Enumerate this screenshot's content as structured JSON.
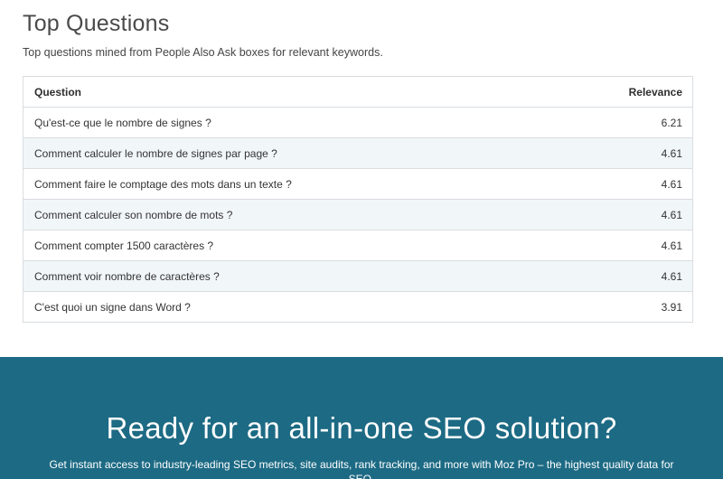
{
  "section": {
    "title": "Top Questions",
    "subtitle": "Top questions mined from People Also Ask boxes for relevant keywords."
  },
  "table": {
    "headers": {
      "question": "Question",
      "relevance": "Relevance"
    },
    "rows": [
      {
        "question": "Qu'est-ce que le nombre de signes ?",
        "relevance": "6.21"
      },
      {
        "question": "Comment calculer le nombre de signes par page ?",
        "relevance": "4.61"
      },
      {
        "question": "Comment faire le comptage des mots dans un texte ?",
        "relevance": "4.61"
      },
      {
        "question": "Comment calculer son nombre de mots ?",
        "relevance": "4.61"
      },
      {
        "question": "Comment compter 1500 caractères ?",
        "relevance": "4.61"
      },
      {
        "question": "Comment voir nombre de caractères ?",
        "relevance": "4.61"
      },
      {
        "question": "C'est quoi un signe dans Word ?",
        "relevance": "3.91"
      }
    ]
  },
  "cta": {
    "heading": "Ready for an all-in-one SEO solution?",
    "body": "Get instant access to industry-leading SEO metrics, site audits, rank tracking, and more with Moz Pro – the highest quality data for SEO."
  },
  "colors": {
    "cta_background": "#1d6a84",
    "row_stripe": "#f1f6f9",
    "table_border": "#d9dde0"
  }
}
